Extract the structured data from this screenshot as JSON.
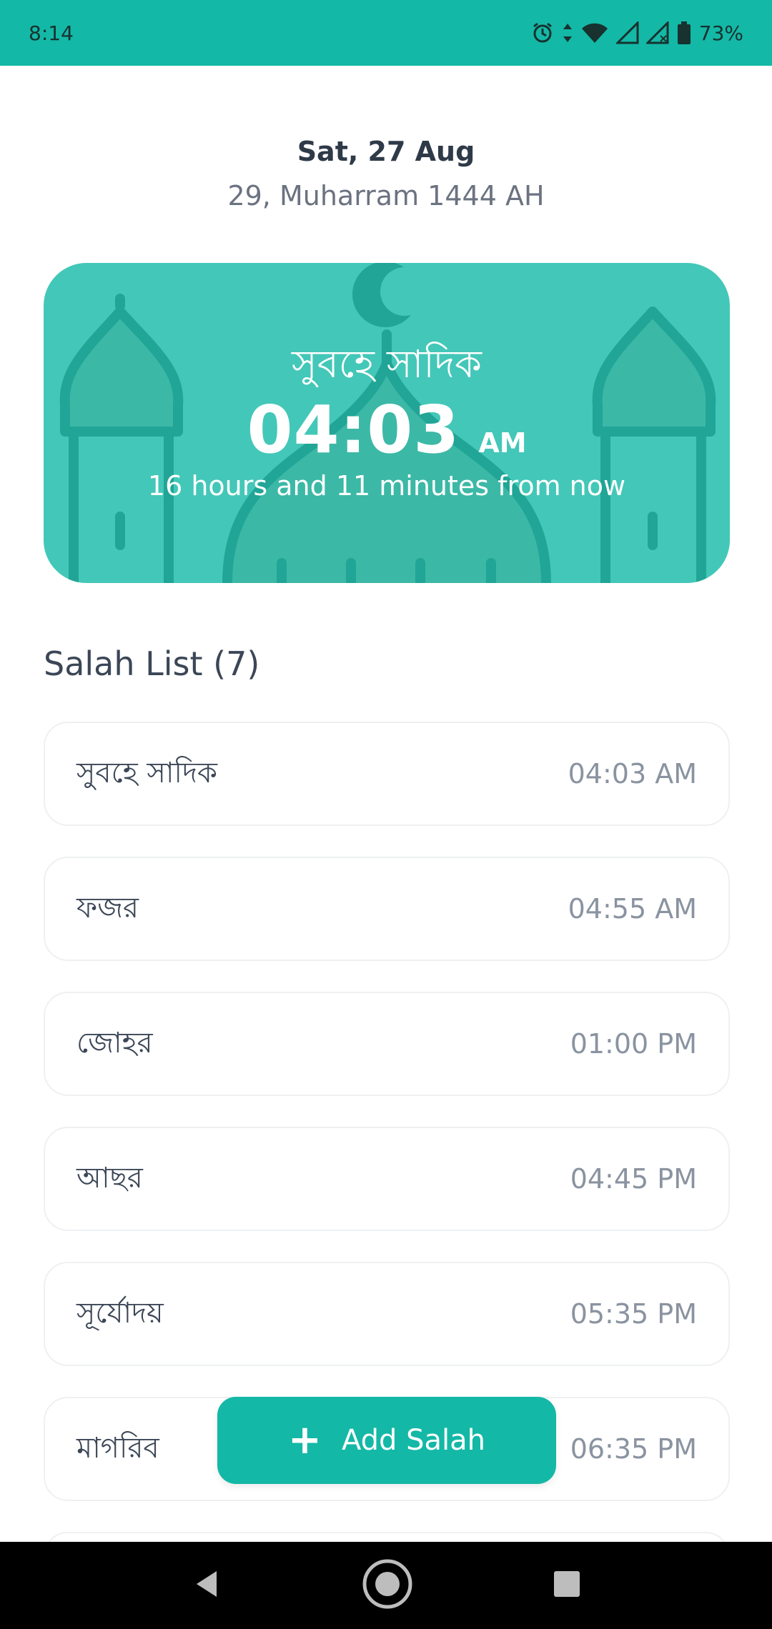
{
  "status_bar": {
    "time": "8:14",
    "battery": "73%",
    "icons": [
      "alarm-icon",
      "data-arrows-icon",
      "wifi-icon",
      "signal-icon",
      "signal-no-sim-icon",
      "battery-icon"
    ]
  },
  "header": {
    "gregorian_date": "Sat, 27 Aug",
    "hijri_date": "29, Muharram 1444 AH"
  },
  "next_prayer": {
    "name": "সুবহে সাদিক",
    "time": "04:03",
    "ampm": "AM",
    "remaining": "16 hours and 11 minutes from now",
    "art": "mosque-illustration"
  },
  "salah_list": {
    "title": "Salah List (7)",
    "items": [
      {
        "name": "সুবহে সাদিক",
        "time": "04:03 AM"
      },
      {
        "name": "ফজর",
        "time": "04:55 AM"
      },
      {
        "name": "জোহর",
        "time": "01:00 PM"
      },
      {
        "name": "আছর",
        "time": "04:45 PM"
      },
      {
        "name": "সূর্যোদয়",
        "time": "05:35 PM"
      },
      {
        "name": "মাগরিব",
        "time": "06:35 PM"
      }
    ]
  },
  "add_button": {
    "label": "Add Salah",
    "icon": "plus-icon"
  },
  "colors": {
    "accent": "#14b8a6",
    "card": "#43c7b8",
    "card_art": "#20a596"
  }
}
